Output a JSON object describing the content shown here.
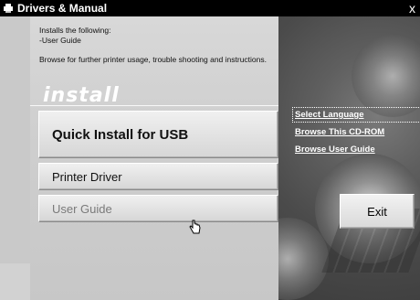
{
  "window": {
    "title": "Drivers & Manual",
    "close_label": "x"
  },
  "install_info": {
    "line1": "Installs the following:",
    "line2": "-User Guide",
    "line3": "Browse for further printer usage, trouble shooting and instructions."
  },
  "section": {
    "heading": "install"
  },
  "buttons": {
    "quick_install_usb": "Quick Install for USB",
    "printer_driver": "Printer Driver",
    "user_guide": "User Guide",
    "exit": "Exit"
  },
  "links": [
    {
      "label": "Select Language",
      "selected": true
    },
    {
      "label": "Browse This CD-ROM",
      "selected": false
    },
    {
      "label": "Browse User Guide",
      "selected": false
    }
  ],
  "icons": {
    "app": "printer-icon",
    "close": "close-icon",
    "cursor": "hand-pointer-icon"
  }
}
